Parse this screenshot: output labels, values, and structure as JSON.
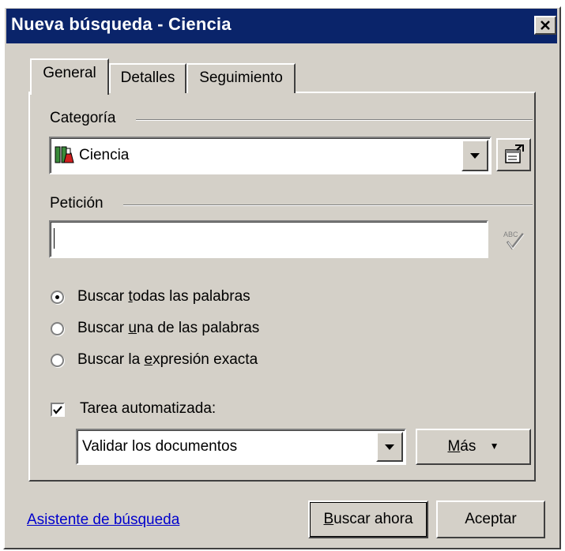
{
  "window": {
    "title": "Nueva búsqueda - Ciencia",
    "close_glyph": "✕"
  },
  "tabs": [
    {
      "label": "General",
      "selected": true
    },
    {
      "label": "Detalles",
      "selected": false
    },
    {
      "label": "Seguimiento",
      "selected": false
    }
  ],
  "categoria": {
    "label": "Categoría",
    "value": "Ciencia",
    "icon": "science-flask-icon",
    "properties_icon": "properties-icon"
  },
  "peticion": {
    "label": "Petición",
    "value": "",
    "spellcheck_icon": "spellcheck-icon"
  },
  "search_mode": {
    "options": [
      {
        "before": "Buscar ",
        "accel": "t",
        "after": "odas las palabras",
        "selected": true
      },
      {
        "before": "Buscar ",
        "accel": "u",
        "after": "na de las palabras",
        "selected": false
      },
      {
        "before": "Buscar la ",
        "accel": "e",
        "after": "xpresión exacta",
        "selected": false
      }
    ]
  },
  "tarea": {
    "label": "Tarea automatizada:",
    "checked": true,
    "value": "Validar los documentos",
    "mas_accel": "M",
    "mas_rest": "ás",
    "mas_arrow": "▼"
  },
  "footer": {
    "link": "Asistente de búsqueda",
    "buscar_accel": "B",
    "buscar_rest": "uscar ahora",
    "aceptar": "Aceptar"
  }
}
